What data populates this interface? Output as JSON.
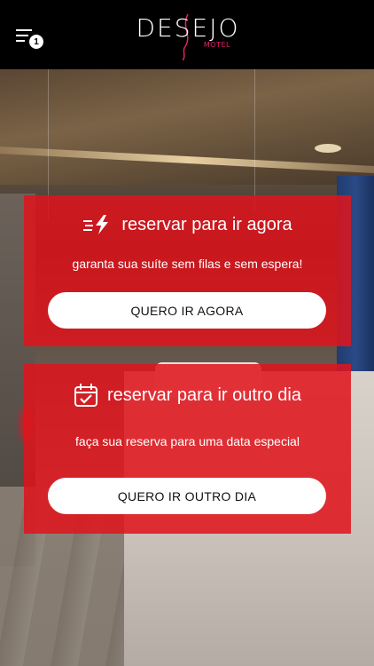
{
  "header": {
    "menu_badge": "1",
    "logo_main": "DESEJO",
    "logo_sub": "MOTEL"
  },
  "card_now": {
    "icon": "fast-bolt-icon",
    "title": "reservar para ir agora",
    "subtitle": "garanta sua suíte sem filas e sem espera!",
    "button_label": "QUERO IR AGORA"
  },
  "card_other": {
    "icon": "calendar-check-icon",
    "title": "reservar para ir outro dia",
    "subtitle": "faça sua reserva para uma data especial",
    "button_label": "QUERO IR OUTRO DIA"
  },
  "colors": {
    "card_red": "#df141c",
    "header_bg": "#000000",
    "logo_accent": "#e0246a"
  }
}
